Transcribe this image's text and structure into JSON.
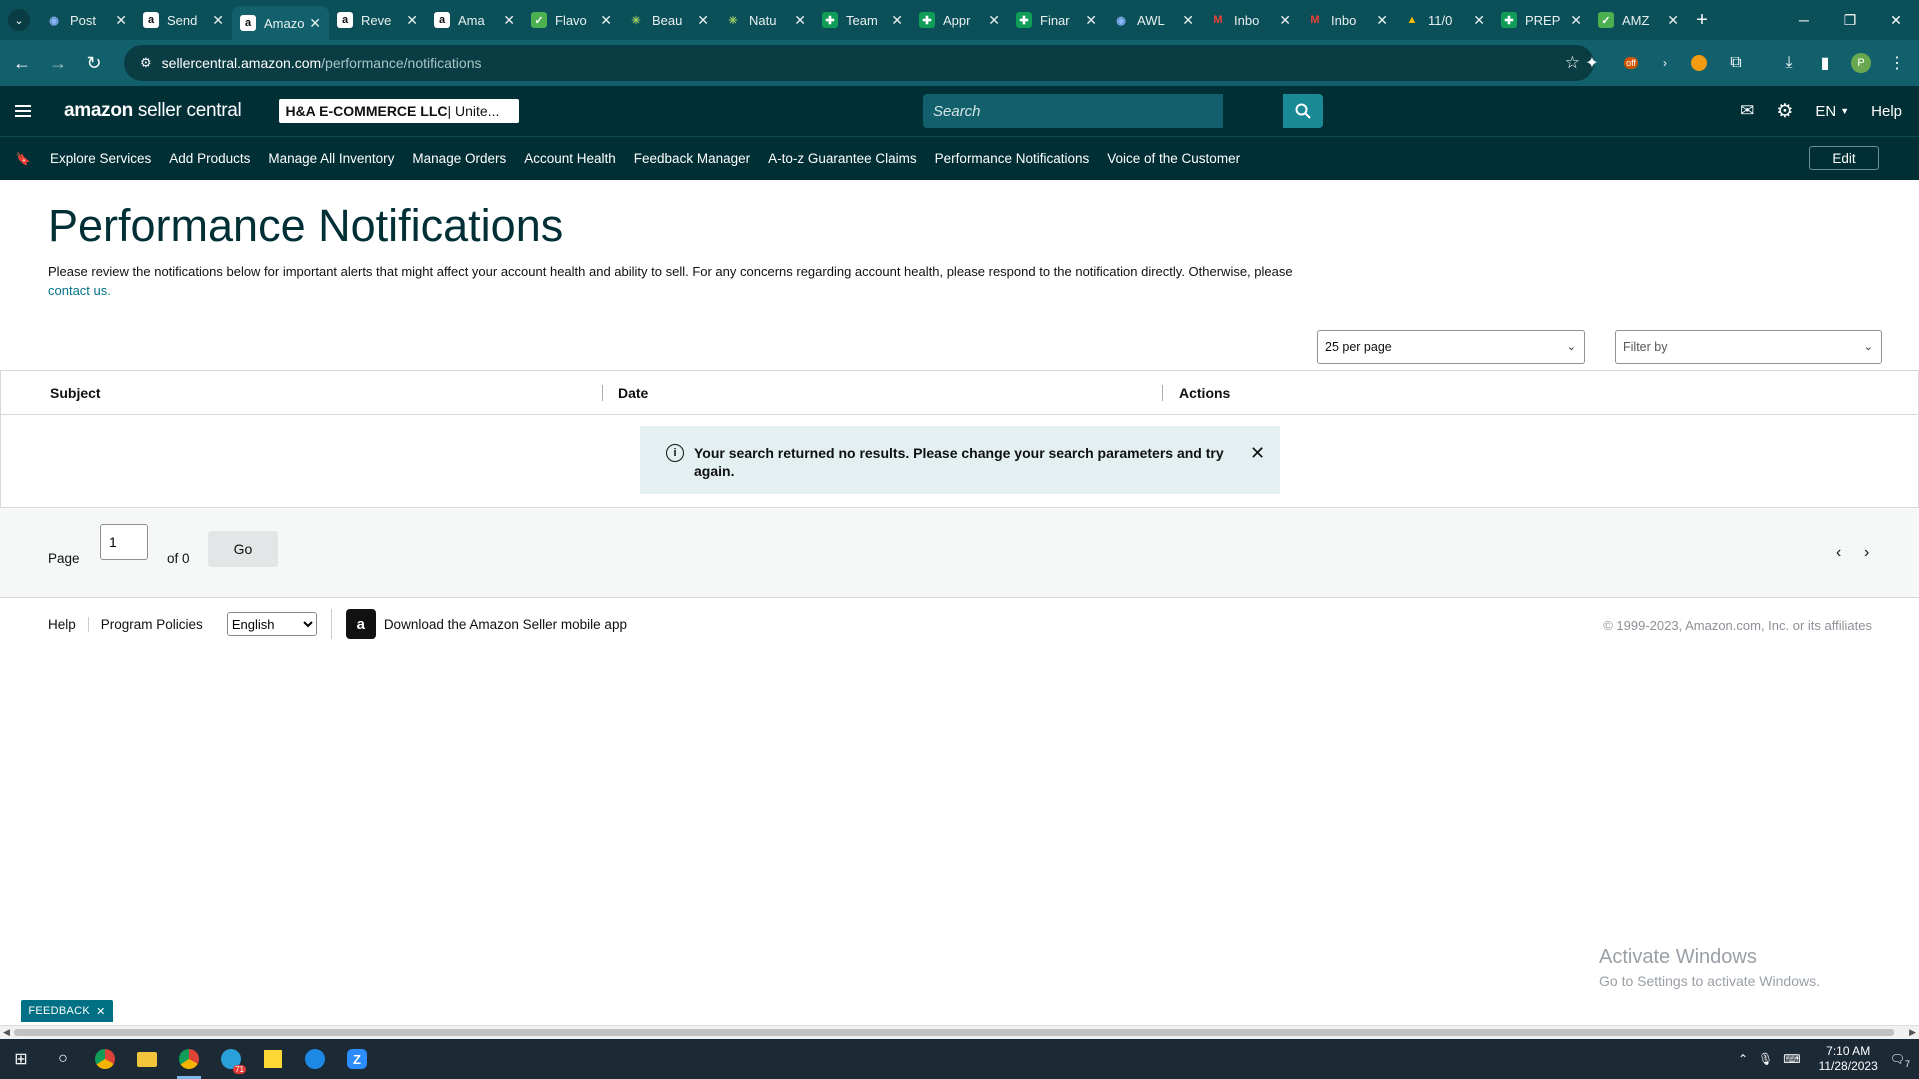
{
  "browser": {
    "tabs": [
      {
        "title": "Post",
        "icon": "globe-icon",
        "active": false
      },
      {
        "title": "Send",
        "icon": "amazon-icon",
        "active": false
      },
      {
        "title": "Amazon",
        "icon": "amazon-icon",
        "active": true
      },
      {
        "title": "Reve",
        "icon": "amazon-icon",
        "active": false
      },
      {
        "title": "Ama",
        "icon": "amazon-icon",
        "active": false
      },
      {
        "title": "Flavo",
        "icon": "brand-icon",
        "active": false
      },
      {
        "title": "Beau",
        "icon": "star-icon",
        "active": false
      },
      {
        "title": "Natu",
        "icon": "star-icon",
        "active": false
      },
      {
        "title": "Team",
        "icon": "sheets-icon",
        "active": false
      },
      {
        "title": "Appr",
        "icon": "sheets-icon",
        "active": false
      },
      {
        "title": "Finar",
        "icon": "sheets-icon",
        "active": false
      },
      {
        "title": "AWL",
        "icon": "globe-icon",
        "active": false
      },
      {
        "title": "Inbo",
        "icon": "gmail-icon",
        "active": false
      },
      {
        "title": "Inbo",
        "icon": "gmail-icon",
        "active": false
      },
      {
        "title": "11/0",
        "icon": "drive-icon",
        "active": false
      },
      {
        "title": "PREP",
        "icon": "sheets-icon",
        "active": false
      },
      {
        "title": "AMZ",
        "icon": "brand-icon",
        "active": false
      }
    ],
    "url_host": "sellercentral.amazon.com",
    "url_path": "/performance/notifications",
    "profile_initial": "P",
    "extension_badge": "off"
  },
  "header": {
    "logo_bold": "amazon",
    "logo_rest": " seller central",
    "store_bold": "H&A E-COMMERCE LLC",
    "store_rest": " | Unite...",
    "search_placeholder": "Search",
    "lang": "EN",
    "help": "Help"
  },
  "nav": {
    "items": [
      "Explore Services",
      "Add Products",
      "Manage All Inventory",
      "Manage Orders",
      "Account Health",
      "Feedback Manager",
      "A-to-z Guarantee Claims",
      "Performance Notifications",
      "Voice of the Customer"
    ],
    "edit": "Edit"
  },
  "page": {
    "title": "Performance Notifications",
    "desc": "Please review the notifications below for important alerts that might affect your account health and ability to sell. For any concerns regarding account health, please respond to the notification directly. Otherwise, please ",
    "contact_link": "contact us.",
    "per_page": "25 per page",
    "filter": "Filter by",
    "columns": [
      "Subject",
      "Date",
      "Actions"
    ],
    "alert": "Your search returned no results. Please change your search parameters and try again.",
    "pager": {
      "page_label": "Page",
      "page_value": "1",
      "of_label": "of 0",
      "go": "Go"
    }
  },
  "footer": {
    "help": "Help",
    "policies": "Program Policies",
    "language": "English",
    "app": "Download the Amazon Seller mobile app",
    "copyright": "© 1999-2023, Amazon.com, Inc. or its affiliates"
  },
  "overlay": {
    "activate_title": "Activate Windows",
    "activate_sub": "Go to Settings to activate Windows.",
    "feedback": "FEEDBACK"
  },
  "taskbar": {
    "time": "7:10 AM",
    "date": "11/28/2023",
    "badge": "71",
    "notif_count": "7"
  }
}
